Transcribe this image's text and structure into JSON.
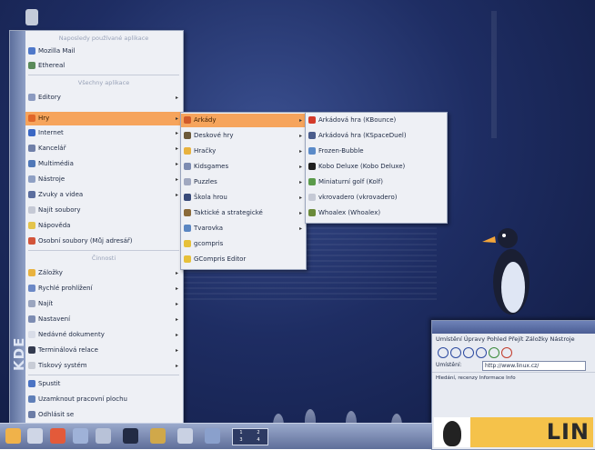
{
  "menu": {
    "sidebar_text": "KDE",
    "recent_header": "Naposledy používané aplikace",
    "recent": [
      "Mozilla Mail",
      "Ethereal"
    ],
    "all_header": "Všechny aplikace",
    "apps": [
      "Editory",
      "Hry",
      "Internet",
      "Kancelář",
      "Multimédia",
      "Nástroje",
      "Zvuky a videa",
      "Najít soubory",
      "Nápověda",
      "Osobní soubory (Můj adresář)"
    ],
    "actions_header": "Činnosti",
    "actions": [
      "Záložky",
      "Rychlé prohlížení",
      "Najít",
      "Nastavení",
      "Nedávné dokumenty",
      "Terminálová relace",
      "Tiskový systém",
      "Spustit",
      "Uzamknout pracovní plochu",
      "Odhlásit se"
    ]
  },
  "games_submenu": [
    "Arkády",
    "Deskové hry",
    "Hračky",
    "Kidsgames",
    "Puzzles",
    "Škola hrou",
    "Taktické a strategické",
    "Tvarovka",
    "gcompris",
    "GCompris Editor"
  ],
  "arcade_submenu": [
    "Arkádová hra (KBounce)",
    "Arkádová hra (KSpaceDuel)",
    "Frozen-Bubble",
    "Kobo Deluxe (Kobo Deluxe)",
    "Miniaturní golf (Kolf)",
    "vkrovadero (vkrovadero)",
    "Whoalex (Whoalex)"
  ],
  "browser": {
    "menu": "Umístění  Úpravy  Pohled  Přejít  Záložky  Nástroje",
    "address_label": "Umístění:",
    "address_value": "http://www.linux.cz/",
    "bookmarks": "Hledání, recenzy  Informace  Info",
    "banner": "LIN"
  },
  "pager": [
    "1",
    "2",
    "3",
    "4"
  ],
  "colors": {
    "highlight": "#f6a45c",
    "menu_bg": "#eef0f5",
    "desktop": "#1e2d63"
  }
}
